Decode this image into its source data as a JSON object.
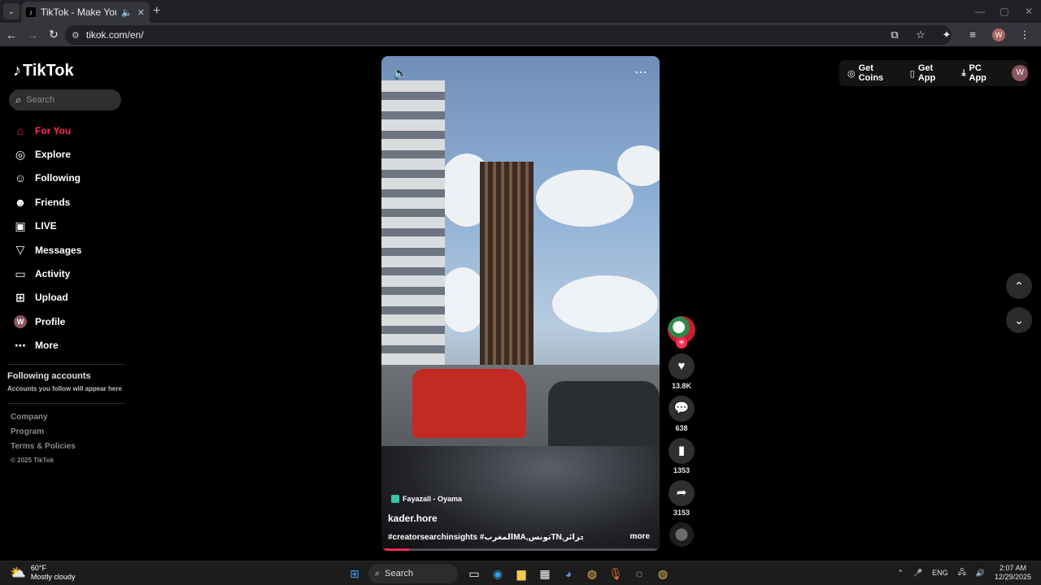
{
  "browser": {
    "tab_title": "TikTok - Make Your Day",
    "url": "tikok.com/en/"
  },
  "sidebar": {
    "logo": "TikTok",
    "search_placeholder": "Search",
    "nav": [
      {
        "label": "For You"
      },
      {
        "label": "Explore"
      },
      {
        "label": "Following"
      },
      {
        "label": "Friends"
      },
      {
        "label": "LIVE"
      },
      {
        "label": "Messages"
      },
      {
        "label": "Activity"
      },
      {
        "label": "Upload"
      },
      {
        "label": "Profile",
        "avatar": "W"
      },
      {
        "label": "More"
      }
    ],
    "following_title": "Following accounts",
    "following_sub": "Accounts you follow will appear here",
    "footer": [
      "Company",
      "Program",
      "Terms & Policies"
    ],
    "copyright": "© 2025 TikTok"
  },
  "video": {
    "music": "Fayazall - Oyama",
    "author": "kader.hore",
    "caption": "#creatorsearchinsights #المغربMA,تونسTN,الجزائرDZ ...",
    "more": "more",
    "progress": 0.1
  },
  "actions": {
    "likes": "13.8K",
    "comments": "638",
    "saves": "1353",
    "shares": "3153"
  },
  "top_right": {
    "coins": "Get Coins",
    "app": "Get App",
    "pc_app": "PC App",
    "avatar": "W"
  },
  "taskbar": {
    "temp": "60°F",
    "weather": "Mostly cloudy",
    "search": "Search",
    "lang": "ENG",
    "time": "2:07 AM",
    "date": "12/29/2025"
  }
}
